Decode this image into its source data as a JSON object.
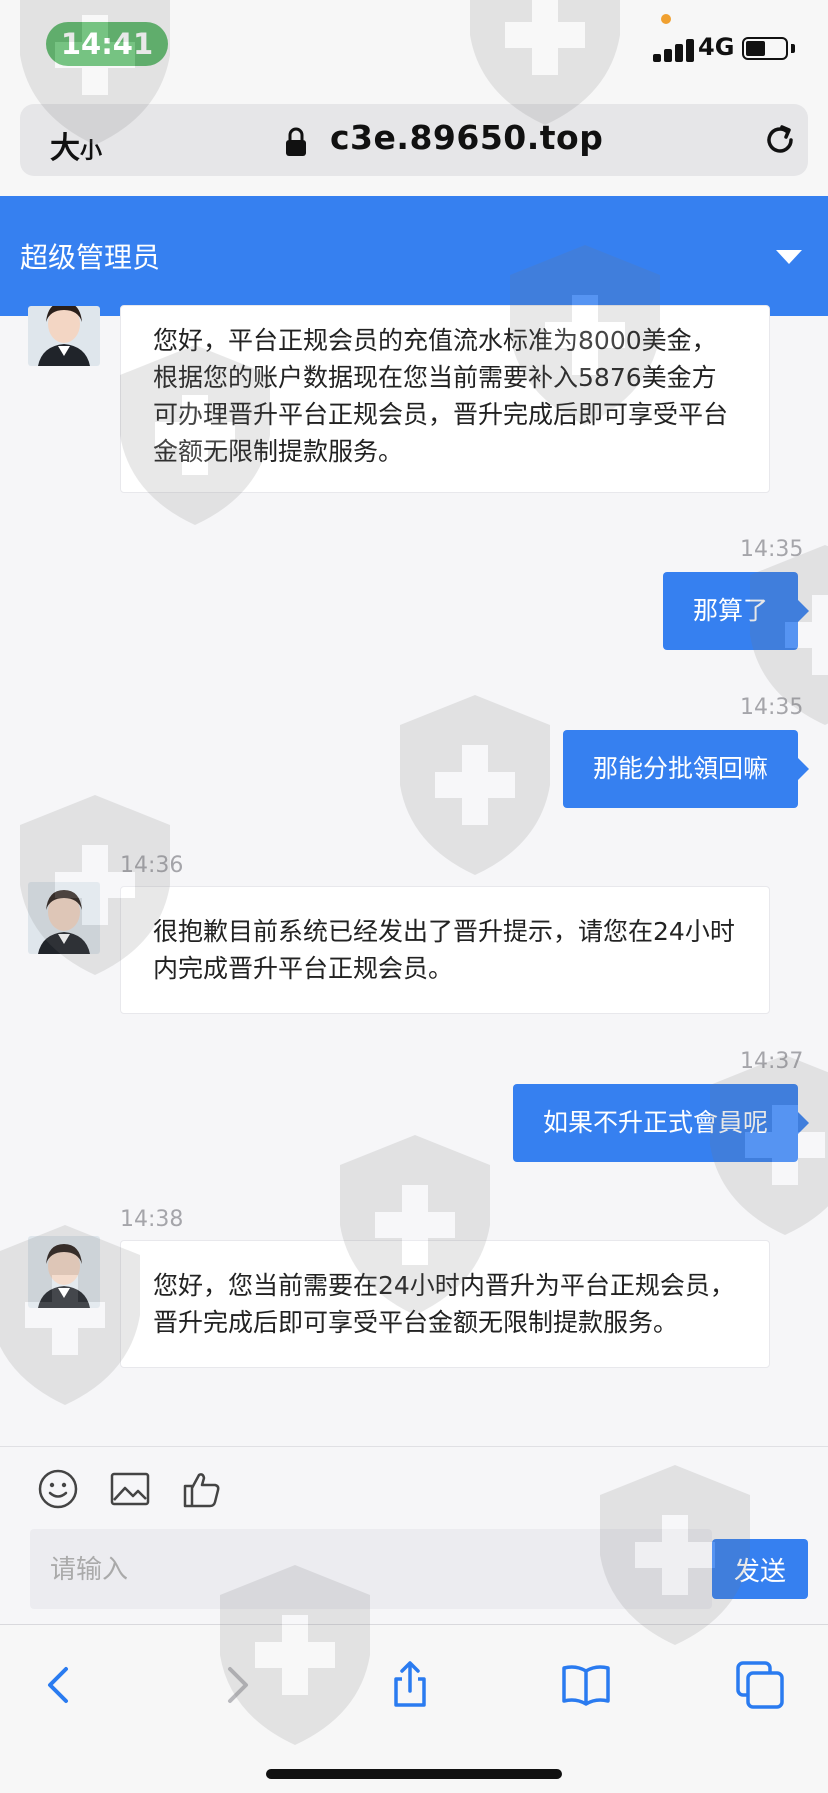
{
  "status_bar": {
    "time": "14:41",
    "network": "4G",
    "battery_level": 0.5
  },
  "browser": {
    "text_size_label_big": "大",
    "text_size_label_small": "小",
    "url": "c3e.89650.top"
  },
  "chat": {
    "title": "超级管理员",
    "messages": [
      {
        "from": "agent",
        "time": "",
        "text": "您好，平台正规会员的充值流水标准为8000美金，根据您的账户数据现在您当前需要补入5876美金方可办理晋升平台正规会员，晋升完成后即可享受平台金额无限制提款服务。"
      },
      {
        "from": "user",
        "time": "14:35",
        "text": "那算了"
      },
      {
        "from": "user",
        "time": "14:35",
        "text": "那能分批領回嘛"
      },
      {
        "from": "agent",
        "time": "14:36",
        "text": "很抱歉目前系统已经发出了晋升提示，请您在24小时内完成晋升平台正规会员。"
      },
      {
        "from": "user",
        "time": "14:37",
        "text": "如果不升正式會員呢"
      },
      {
        "from": "agent",
        "time": "14:38",
        "text": "您好，您当前需要在24小时内晋升为平台正规会员，晋升完成后即可享受平台金额无限制提款服务。"
      }
    ]
  },
  "composer": {
    "placeholder": "请输入",
    "value": "",
    "send_label": "发送"
  },
  "colors": {
    "accent": "#3680f0",
    "status_pill": "#5cb86a"
  }
}
